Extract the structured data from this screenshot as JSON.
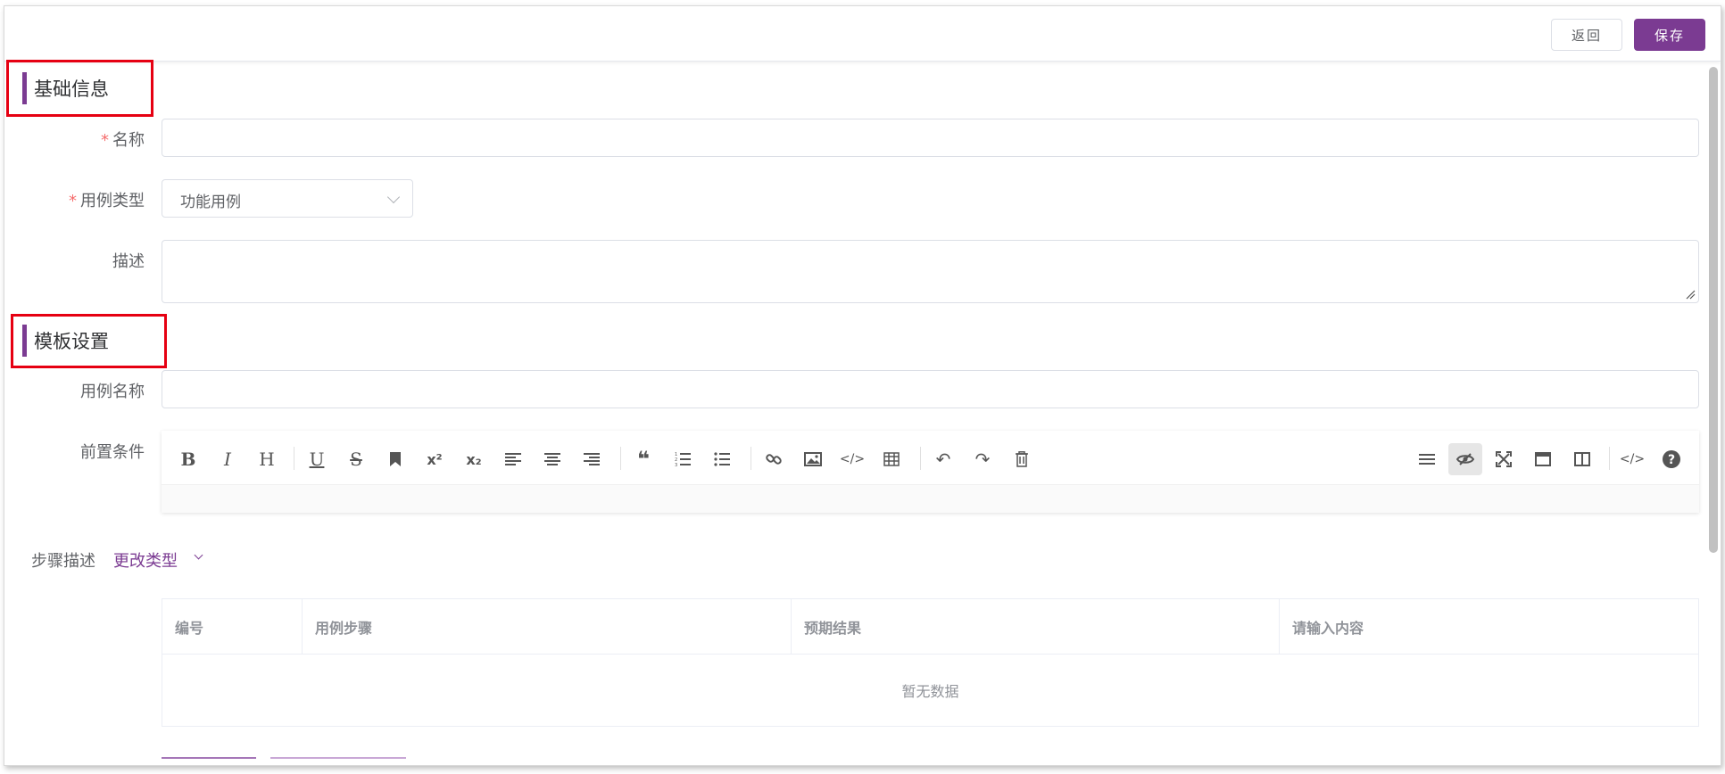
{
  "toolbar": {
    "back_label": "返回",
    "save_label": "保存"
  },
  "sections": {
    "basic": "基础信息",
    "template": "模板设置"
  },
  "form": {
    "name_label": "名称",
    "case_type_label": "用例类型",
    "case_type_value": "功能用例",
    "description_label": "描述",
    "case_name_label": "用例名称",
    "precondition_label": "前置条件",
    "step_desc_label": "步骤描述",
    "change_type_link": "更改类型",
    "required_mark": "*"
  },
  "editor_icons": {
    "left": [
      "bold-icon",
      "italic-icon",
      "heading-icon",
      "underline-icon",
      "strikethrough-icon",
      "bookmark-icon",
      "superscript-icon",
      "subscript-icon",
      "align-left-icon",
      "align-center-icon",
      "align-right-icon",
      "quote-icon",
      "ordered-list-icon",
      "unordered-list-icon",
      "link-icon",
      "image-icon",
      "code-icon",
      "table-icon",
      "undo-icon",
      "redo-icon",
      "trash-icon"
    ],
    "right": [
      "menu-icon",
      "preview-toggle-icon",
      "fullscreen-icon",
      "window-icon",
      "split-view-icon",
      "source-code-icon",
      "help-icon"
    ]
  },
  "steps_table": {
    "columns": [
      "编号",
      "用例步骤",
      "预期结果",
      "请输入内容"
    ],
    "empty_text": "暂无数据"
  },
  "colors": {
    "accent": "#7b3b92",
    "required": "#f56c6c",
    "highlight_box": "#e60012"
  }
}
